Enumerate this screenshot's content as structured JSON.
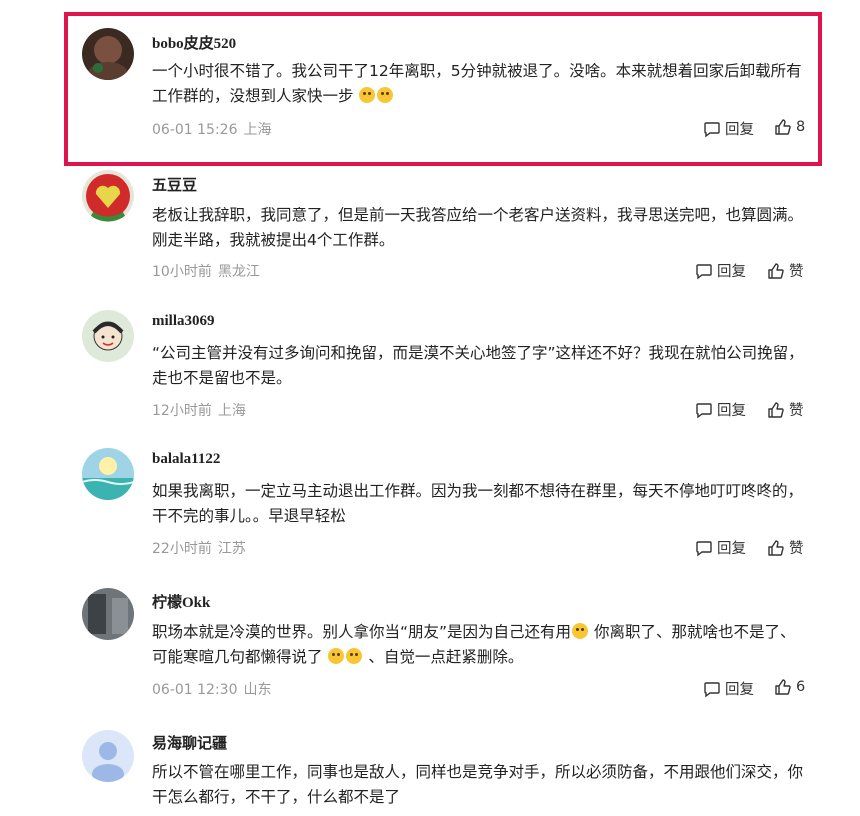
{
  "comments": [
    {
      "username": "bobo皮皮520",
      "lines": [
        "一个小时很不错了。我公司干了12年离职，5分钟就被退了。没啥。本来就想着回家后卸载所有",
        "工作群的，没想到人家快一步"
      ],
      "emojis": [
        "rofl-emoji",
        "smile-emoji"
      ],
      "time": "06-01 15:26",
      "location": "上海",
      "reply_label": "回复",
      "like_label": "8",
      "highlighted": true
    },
    {
      "username": "五豆豆",
      "lines": [
        "老板让我辞职，我同意了，但是前一天我答应给一个老客户送资料，我寻思送完吧，也算圆满。",
        "刚走半路，我就被提出4个工作群。"
      ],
      "time": "10小时前",
      "location": "黑龙江",
      "reply_label": "回复",
      "like_label": "赞"
    },
    {
      "username": "milla3069",
      "lines": [
        "“公司主管并没有过多询问和挽留，而是漠不关心地签了字”这样还不好？我现在就怕公司挽留，",
        "走也不是留也不是。"
      ],
      "time": "12小时前",
      "location": "上海",
      "reply_label": "回复",
      "like_label": "赞"
    },
    {
      "username": "balala1122",
      "lines": [
        "如果我离职，一定立马主动退出工作群。因为我一刻都不想待在群里，每天不停地叮叮咚咚的，",
        "干不完的事儿。。早退早轻松"
      ],
      "time": "22小时前",
      "location": "江苏",
      "reply_label": "回复",
      "like_label": "赞"
    },
    {
      "username": "柠檬Okk",
      "lines": [
        "职场本就是冷漠的世界。别人拿你当“朋友”是因为自己还有用",
        "可能寒暄几句都懒得说了",
        "、自觉一点赶紧删除。"
      ],
      "line1_tail": "你离职了、那就啥也不是了、",
      "time": "06-01 12:30",
      "location": "山东",
      "reply_label": "回复",
      "like_label": "6"
    },
    {
      "username": "易海聊记疆",
      "lines": [
        "所以不管在哪里工作，同事也是敌人，同样也是竞争对手，所以必须防备，不用跟他们深交，你",
        "干怎么都行，不干了，什么都不是了"
      ]
    }
  ]
}
